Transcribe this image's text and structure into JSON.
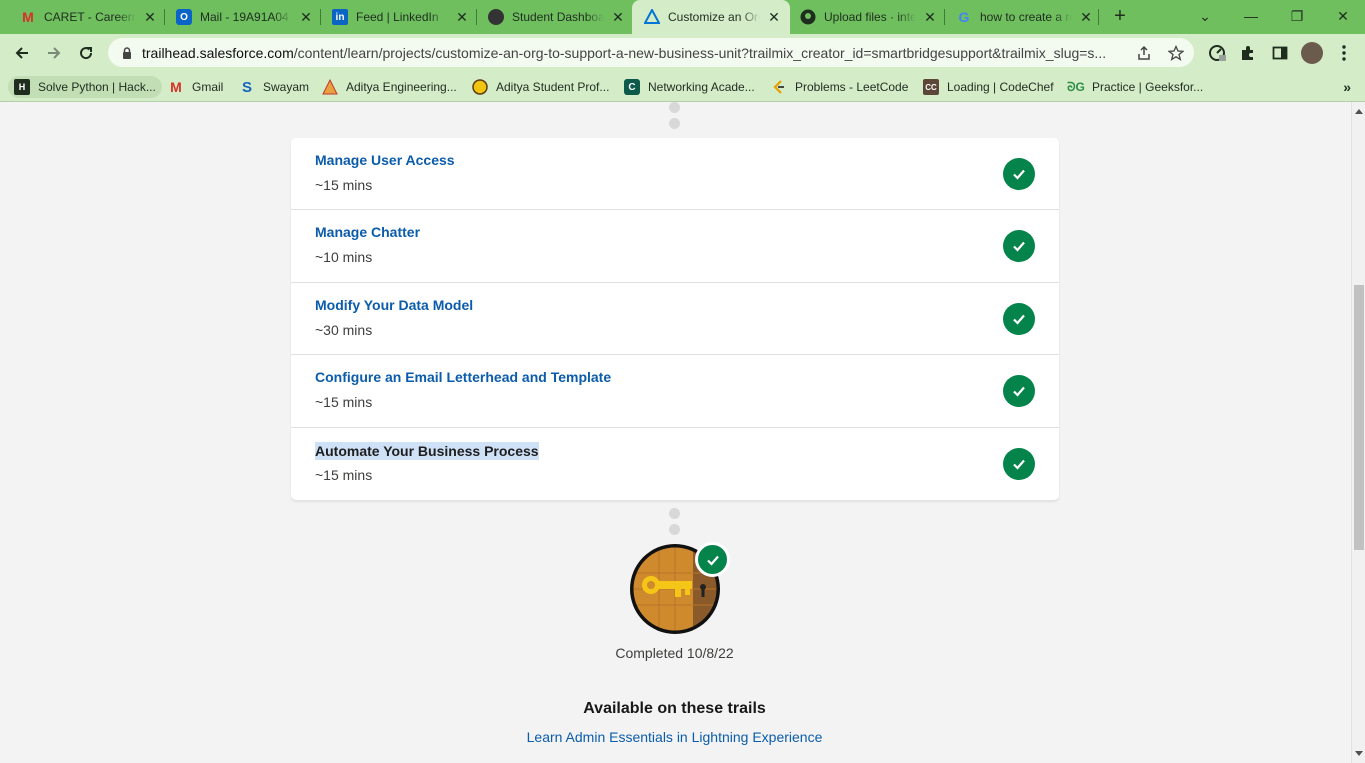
{
  "browser": {
    "tabs": [
      {
        "title": "CARET - Careernet",
        "icon": "gmail-icon"
      },
      {
        "title": "Mail - 19A91A04",
        "icon": "outlook-icon"
      },
      {
        "title": "Feed | LinkedIn",
        "icon": "linkedin-icon"
      },
      {
        "title": "Student Dashboard",
        "icon": "globe-icon"
      },
      {
        "title": "Customize an Org",
        "icon": "trailhead-icon"
      },
      {
        "title": "Upload files · intern",
        "icon": "github-icon"
      },
      {
        "title": "how to create a repo",
        "icon": "google-icon"
      }
    ],
    "active_tab": 4,
    "url_host": "trailhead.salesforce.com",
    "url_path": "/content/learn/projects/customize-an-org-to-support-a-new-business-unit?trailmix_creator_id=smartbridgesupport&trailmix_slug=s...",
    "bookmarks": [
      {
        "label": "Solve Python | Hack...",
        "icon": "hackerrank-icon"
      },
      {
        "label": "Gmail",
        "icon": "gmail-icon"
      },
      {
        "label": "Swayam",
        "icon": "swayam-icon"
      },
      {
        "label": "Aditya Engineering...",
        "icon": "college-icon"
      },
      {
        "label": "Aditya Student Prof...",
        "icon": "student-icon"
      },
      {
        "label": "Networking Acade...",
        "icon": "cisco-icon"
      },
      {
        "label": "Problems - LeetCode",
        "icon": "leetcode-icon"
      },
      {
        "label": "Loading | CodeChef",
        "icon": "codechef-icon"
      },
      {
        "label": "Practice | Geeksfor...",
        "icon": "geeksforgeeks-icon"
      }
    ],
    "colors": {
      "chrome_frame": "#6fbf5f",
      "chrome_toolbar": "#d5ecc9"
    }
  },
  "units": [
    {
      "title": "Manage User Access",
      "time": "~15 mins",
      "status": "completed"
    },
    {
      "title": "Manage Chatter",
      "time": "~10 mins",
      "status": "completed"
    },
    {
      "title": "Modify Your Data Model",
      "time": "~30 mins",
      "status": "completed"
    },
    {
      "title": "Configure an Email Letterhead and Template",
      "time": "~15 mins",
      "status": "completed"
    },
    {
      "title": "Automate Your Business Process",
      "time": "~15 mins",
      "status": "completed",
      "selected": true
    }
  ],
  "badge": {
    "icon": "key-badge-icon",
    "completed_text": "Completed 10/8/22"
  },
  "trails": {
    "heading": "Available on these trails",
    "links": [
      "Learn Admin Essentials in Lightning Experience"
    ]
  },
  "colors": {
    "link": "#0b5cab",
    "check_green": "#04844b",
    "page_bg": "#f3f3f3"
  }
}
